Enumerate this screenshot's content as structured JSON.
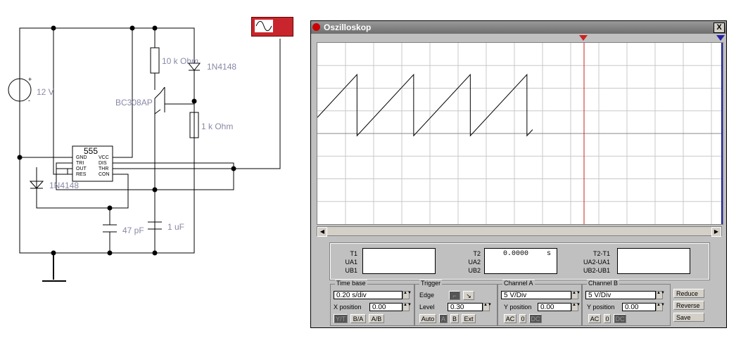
{
  "circuit": {
    "source": "12 V",
    "r1": "10 k Ohm",
    "d1": "1N4148",
    "transistor": "BC308AP",
    "r2": "1 k Ohm",
    "ic": "555",
    "ic_pins_left": [
      "GND",
      "TRI",
      "OUT",
      "RES"
    ],
    "ic_pins_right": [
      "VCC",
      "DIS",
      "THR",
      "CON"
    ],
    "d2": "1N4148",
    "c1": "47 pF",
    "c2": "1 uF",
    "plus": "+",
    "minus": "-"
  },
  "window": {
    "title": "Oszilloskop",
    "close": "X"
  },
  "cursors": {
    "c1": "1",
    "c2": "2"
  },
  "waveform": {
    "type": "sawtooth",
    "periods_visible": 3.8,
    "min_div": -0.1,
    "max_div": 2.6
  },
  "readout": {
    "t1": "T1",
    "ua1": "UA1",
    "ub1": "UB1",
    "t2": "T2",
    "ua2": "UA2",
    "ub2": "UB2",
    "t2_value": "0.0000",
    "t2_unit": "s",
    "dt": "T2-T1",
    "dua": "UA2-UA1",
    "dub": "UB2-UB1"
  },
  "timebase": {
    "title": "Time base",
    "value": "0.20 s/div",
    "xpos_label": "X position",
    "xpos": "0.00",
    "modes": [
      "Y/T",
      "B/A",
      "A/B"
    ]
  },
  "trigger": {
    "title": "Trigger",
    "edge_label": "Edge",
    "level_label": "Level",
    "level": "0.30",
    "sources": [
      "Auto",
      "A",
      "B",
      "Ext"
    ]
  },
  "channel_a": {
    "title": "Channel A",
    "value": "5  V/Div",
    "ypos_label": "Y position",
    "ypos": "0.00",
    "coupling": [
      "AC",
      "0",
      "DC"
    ]
  },
  "channel_b": {
    "title": "Channel B",
    "value": "5  V/Div",
    "ypos_label": "Y position",
    "ypos": "0.00",
    "coupling": [
      "AC",
      "0",
      "DC"
    ]
  },
  "buttons": {
    "reduce": "Reduce",
    "reverse": "Reverse",
    "save": "Save"
  },
  "colors": {
    "trace": "#000000",
    "cursor1": "#cc2222",
    "cursor2": "#2222aa",
    "grid": "#c8c8c8"
  }
}
